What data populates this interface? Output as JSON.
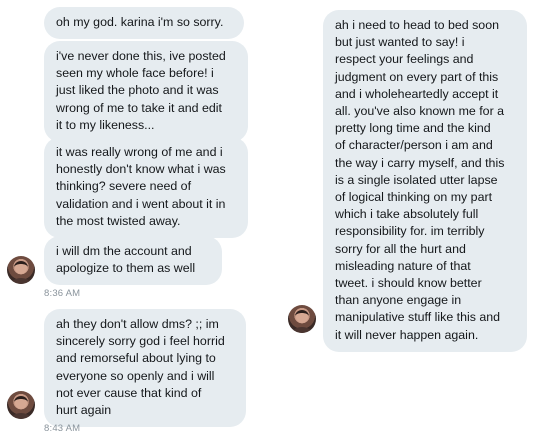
{
  "conversation": {
    "left_messages": [
      {
        "text": "oh my god. karina i'm so sorry."
      },
      {
        "text": "i've never done this, ive posted\nseen my whole face before! i\njust liked the photo and it was\nwrong of me to take it and edit\nit to my likeness..."
      },
      {
        "text": "it was really wrong of me and i\nhonestly don't know what i was\nthinking? severe need of\nvalidation and i went about it in\nthe most twisted away."
      },
      {
        "text": "i will dm the account and\napologize to them as well"
      },
      {
        "text": "ah they don't allow dms? ;; im\nsincerely sorry god i feel horrid\nand remorseful about lying to\neveryone so openly and i will\nnot ever cause that kind of\nhurt again"
      }
    ],
    "right_messages": [
      {
        "text": "ah i need to head to bed soon\nbut just wanted to say! i\nrespect your feelings and\njudgment on every part of this\nand i wholeheartedly accept it\nall. you've also known me for a\npretty long time and the kind\nof character/person i am and\nthe way i carry myself, and this\nis a single isolated utter lapse\nof logical thinking on my part\nwhich i take absolutely full\nresponsibility for. im terribly\nsorry for all the hurt and\nmisleading nature of that\ntweet. i should know better\nthan anyone engage in\nmanipulative stuff like this and\nit will never happen again."
      }
    ],
    "timestamps": [
      "8:36 AM",
      "8:43 AM"
    ]
  },
  "colors": {
    "bubble_background": "#e6ecf0",
    "timestamp_text": "#8a949c"
  }
}
